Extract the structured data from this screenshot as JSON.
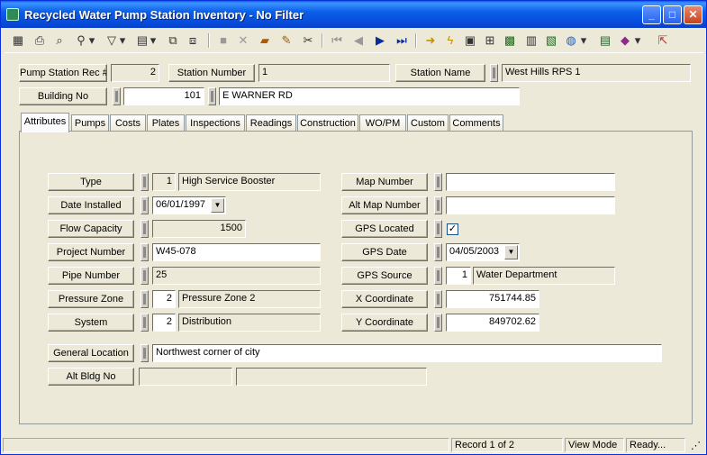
{
  "window": {
    "title": "Recycled Water Pump Station Inventory - No Filter"
  },
  "header": {
    "rec_label": "Pump Station Rec #",
    "rec_value": "2",
    "station_number_label": "Station Number",
    "station_number_value": "1",
    "station_name_label": "Station Name",
    "station_name_value": "West Hills RPS 1",
    "building_no_label": "Building No",
    "building_no_value": "101",
    "building_street": "E WARNER RD"
  },
  "tabs": [
    "Attributes",
    "Pumps",
    "Costs",
    "Plates",
    "Inspections",
    "Readings",
    "Construction",
    "WO/PM",
    "Custom",
    "Comments"
  ],
  "attributes": {
    "type_label": "Type",
    "type_code": "1",
    "type_value": "High Service Booster",
    "date_installed_label": "Date Installed",
    "date_installed_value": "06/01/1997",
    "flow_capacity_label": "Flow Capacity",
    "flow_capacity_value": "1500",
    "project_number_label": "Project Number",
    "project_number_value": "W45-078",
    "pipe_number_label": "Pipe Number",
    "pipe_number_value": "25",
    "pressure_zone_label": "Pressure Zone",
    "pressure_zone_code": "2",
    "pressure_zone_value": "Pressure Zone 2",
    "system_label": "System",
    "system_code": "2",
    "system_value": "Distribution",
    "map_number_label": "Map Number",
    "map_number_value": "",
    "alt_map_number_label": "Alt Map Number",
    "alt_map_number_value": "",
    "gps_located_label": "GPS Located",
    "gps_located_mark": "✓",
    "gps_date_label": "GPS Date",
    "gps_date_value": "04/05/2003",
    "gps_source_label": "GPS Source",
    "gps_source_code": "1",
    "gps_source_value": "Water Department",
    "x_coordinate_label": "X Coordinate",
    "x_coordinate_value": "751744.85",
    "y_coordinate_label": "Y Coordinate",
    "y_coordinate_value": "849702.62",
    "general_location_label": "General Location",
    "general_location_value": "Northwest corner of city",
    "alt_bldg_no_label": "Alt Bldg No",
    "alt_bldg_no_value": "",
    "alt_bldg_street": ""
  },
  "status": {
    "record": "Record 1 of 2",
    "mode": "View Mode",
    "state": "Ready..."
  }
}
